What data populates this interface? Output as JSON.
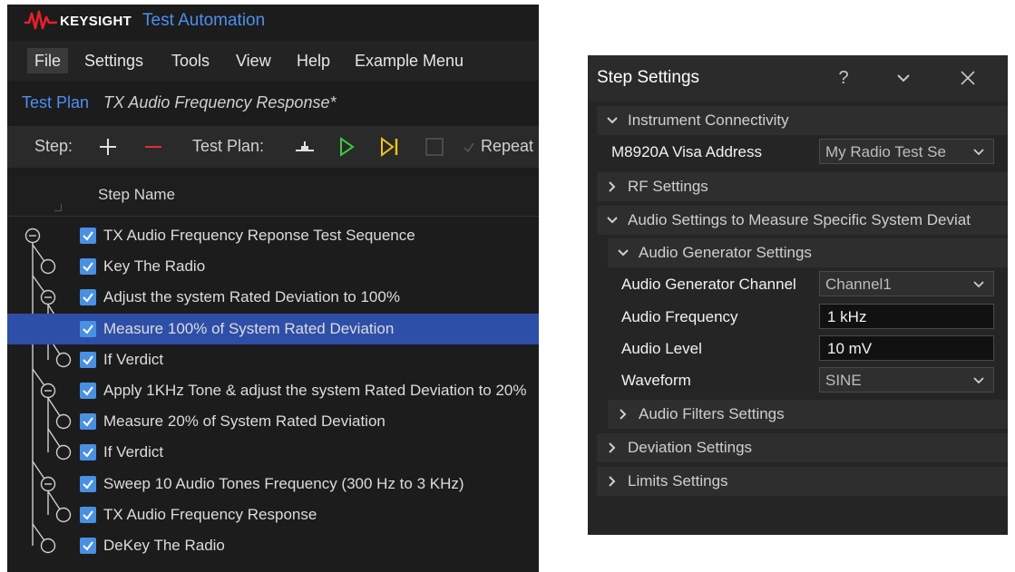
{
  "app": {
    "brand": "KEYSIGHT",
    "title": "Test Automation"
  },
  "menu": [
    "File",
    "Settings",
    "Tools",
    "View",
    "Help",
    "Example Menu"
  ],
  "test_plan": {
    "label": "Test Plan",
    "name": "TX Audio Frequency Response*"
  },
  "toolbar": {
    "step_label": "Step:",
    "plan_label": "Test Plan:",
    "repeat_label": "Repeat",
    "icons": [
      "plus-icon",
      "minus-icon",
      "breakpoint-icon",
      "play-icon",
      "step-run-icon",
      "stop-icon",
      "check-icon"
    ]
  },
  "grid": {
    "column_header": "Step Name"
  },
  "steps": [
    {
      "label": "TX Audio Frequency Reponse Test Sequence",
      "checked": true,
      "selected": false
    },
    {
      "label": "Key The Radio",
      "checked": true,
      "selected": false
    },
    {
      "label": "Adjust the system Rated Deviation to 100%",
      "checked": true,
      "selected": false
    },
    {
      "label": "Measure 100% of System Rated Deviation",
      "checked": true,
      "selected": true
    },
    {
      "label": "If Verdict",
      "checked": true,
      "selected": false
    },
    {
      "label": "Apply 1KHz Tone & adjust the system Rated Deviation to 20%",
      "checked": true,
      "selected": false
    },
    {
      "label": "Measure 20% of System Rated Deviation",
      "checked": true,
      "selected": false
    },
    {
      "label": "If Verdict",
      "checked": true,
      "selected": false
    },
    {
      "label": "Sweep 10 Audio Tones Frequency (300 Hz to 3 KHz)",
      "checked": true,
      "selected": false
    },
    {
      "label": "TX Audio Frequency Response",
      "checked": true,
      "selected": false
    },
    {
      "label": "DeKey The Radio",
      "checked": true,
      "selected": false
    }
  ],
  "step_settings": {
    "title": "Step Settings",
    "help_glyph": "?",
    "sections": {
      "instrument": "Instrument Connectivity",
      "rf": "RF Settings",
      "audio": "Audio Settings to Measure Specific System Deviat",
      "audio_gen": "Audio Generator Settings",
      "audio_filters": "Audio Filters Settings",
      "deviation": "Deviation Settings",
      "limits": "Limits Settings"
    },
    "fields": {
      "visa_label": "M8920A Visa Address",
      "visa_value": "My Radio Test Se",
      "channel_label": "Audio Generator Channel",
      "channel_value": "Channel1",
      "frequency_label": "Audio Frequency",
      "frequency_value": "1 kHz",
      "level_label": "Audio Level",
      "level_value": "10 mV",
      "waveform_label": "Waveform",
      "waveform_value": "SINE"
    }
  },
  "colors": {
    "accent_blue": "#4d8ff0",
    "selection": "#2e4fa8",
    "brand_red": "#e8202a",
    "checkbox": "#4a90e2",
    "play_green": "#3ec93e",
    "step_yellow": "#f0c419"
  }
}
